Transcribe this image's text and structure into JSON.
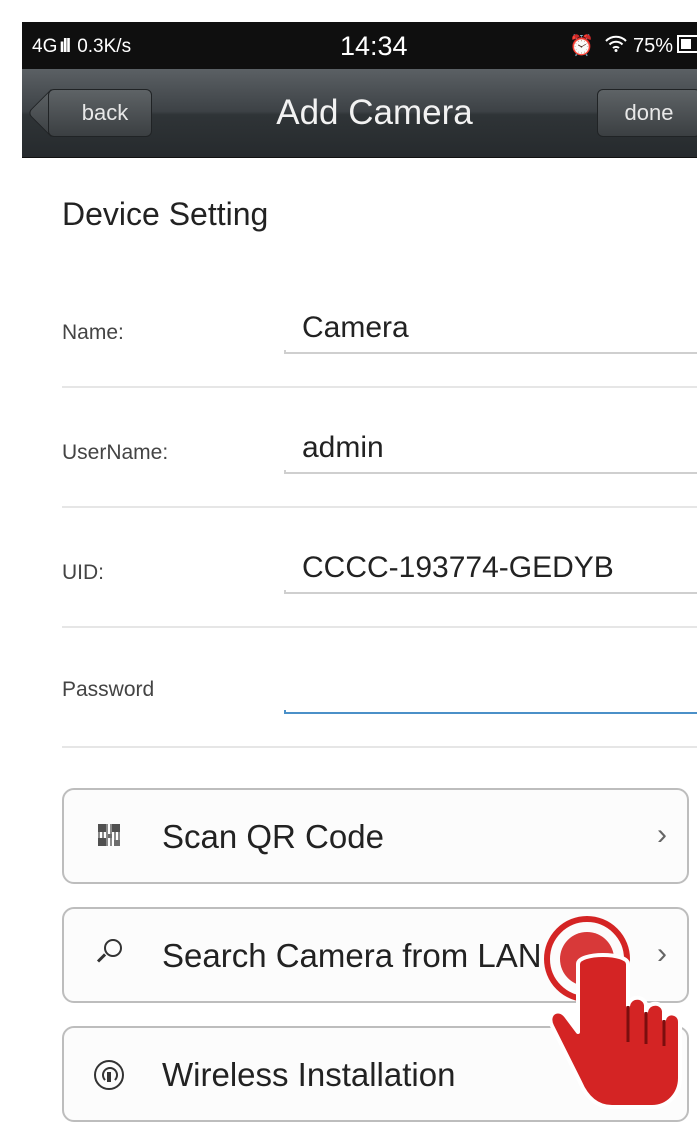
{
  "status_bar": {
    "network": "4G",
    "speed": "0.3K/s",
    "time": "14:34",
    "alarm_icon": "alarm-clock-icon",
    "wifi_icon": "wifi-icon",
    "battery": "75%"
  },
  "nav": {
    "back_label": "back",
    "title": "Add Camera",
    "done_label": "done"
  },
  "section_title": "Device Setting",
  "form": {
    "name": {
      "label": "Name:",
      "value": "Camera"
    },
    "username": {
      "label": "UserName:",
      "value": "admin"
    },
    "uid": {
      "label": "UID:",
      "value": "CCCC-193774-GEDYB"
    },
    "password": {
      "label": "Password",
      "value": ""
    }
  },
  "actions": [
    {
      "label": "Scan QR Code",
      "icon": "qr-code-icon"
    },
    {
      "label": "Search Camera from LAN",
      "icon": "search-icon"
    },
    {
      "label": "Wireless Installation",
      "icon": "wireless-install-icon"
    }
  ],
  "colors": {
    "nav_bg": "#3d4246",
    "active_underline": "#4b90c8",
    "tap_hint_red": "#d42424"
  }
}
